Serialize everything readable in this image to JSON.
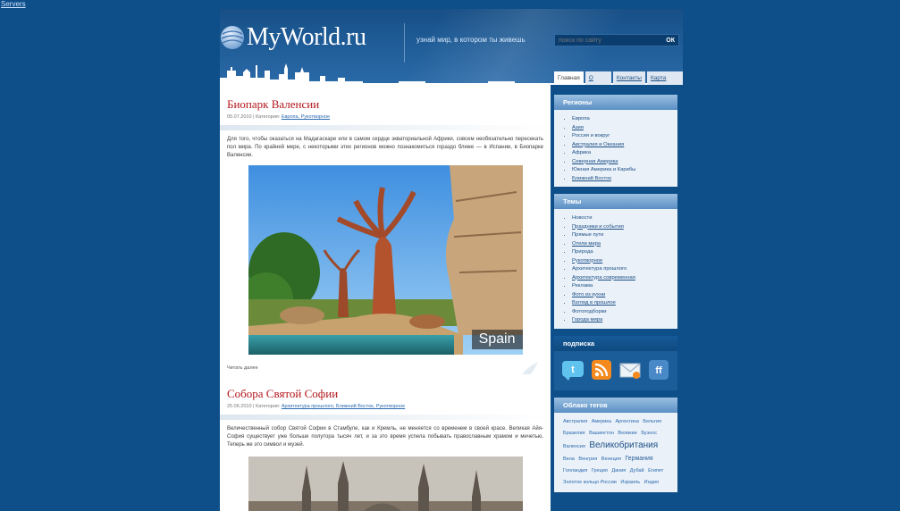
{
  "top_link": "Servers",
  "header": {
    "logo": "MyWorld.ru",
    "slogan": "узнай мир, в котором ты живешь",
    "search": {
      "placeholder": "поиск по сайту",
      "button": "ОК"
    },
    "nav": [
      {
        "label": "Главная",
        "active": true
      },
      {
        "label": "О сайте",
        "active": false
      },
      {
        "label": "Контакты",
        "active": false
      },
      {
        "label": "Карта сайта",
        "active": false
      }
    ]
  },
  "posts": [
    {
      "title": "Биопарк Валенсии",
      "date": "05.07.2010",
      "category_label": "Категория:",
      "categories": "Европа, Рукотворное",
      "excerpt": "Для того, чтобы оказаться на Мадагаскаре или в самом сердце экваториальной Африки, совсем необязательно пересекать пол мира. По крайней мере, с некоторыми этих регионов можно познакомиться гораздо ближе — в Испании, в Биопарке Валенсии.",
      "photo_label": "Spain",
      "author": "Читать далее"
    },
    {
      "title": "Собора Святой Софии",
      "date": "25.06.2010",
      "category_label": "Категория:",
      "categories": "Архитектура прошлого, Ближний Восток, Рукотворное",
      "excerpt": "Величественный собор Святой Софии в Стамбуле, как и Кремль, не меняется со временем в своей красе. Великая Айя-София существует уже больше полутора тысяч лет, и за это время успела побывать православным храмом и мечетью. Теперь же это символ и музей."
    }
  ],
  "sidebar": {
    "regions": {
      "title": "Регионы",
      "items": [
        "Европа",
        "Азия",
        "Россия и вокруг",
        "Австралия и Океания",
        "Африка",
        "Северная Америка",
        "Южная Америка и Карибы",
        "Ближний Восток"
      ]
    },
    "topics": {
      "title": "Темы",
      "items": [
        "Новости",
        "Праздники и события",
        "Прямые пути",
        "Отели мира",
        "Природа",
        "Рукотворное",
        "Архитектура прошлого",
        "Архитектура современная",
        "Реклама",
        "Фото из кухни",
        "Взгляд в прошлое",
        "Фотоподборки",
        "Города мира"
      ]
    },
    "subscribe": {
      "title": "подписка",
      "icons": [
        "twitter-icon",
        "rss-icon",
        "email-icon",
        "friendfeed-icon"
      ]
    },
    "tags": {
      "title": "Облако тегов",
      "items": [
        {
          "t": "Австралия",
          "s": "s"
        },
        {
          "t": "Америка",
          "s": "s"
        },
        {
          "t": "Аргентина",
          "s": "s"
        },
        {
          "t": "Бельгия",
          "s": "s"
        },
        {
          "t": "Бразилия",
          "s": "s"
        },
        {
          "t": "Вашингтон",
          "s": "s"
        },
        {
          "t": "Великие",
          "s": "s"
        },
        {
          "t": "Буэнос",
          "s": "s"
        },
        {
          "t": "Валенсия",
          "s": "s"
        },
        {
          "t": "Великобритания",
          "s": "big"
        },
        {
          "t": "Вена",
          "s": "s"
        },
        {
          "t": "Венгрия",
          "s": "s"
        },
        {
          "t": "Венеция",
          "s": "s"
        },
        {
          "t": "Германия",
          "s": "mid"
        },
        {
          "t": "Голландия",
          "s": "s"
        },
        {
          "t": "Греция",
          "s": "s"
        },
        {
          "t": "Дания",
          "s": "s"
        },
        {
          "t": "Дубай",
          "s": "s"
        },
        {
          "t": "Египет",
          "s": "s"
        },
        {
          "t": "Золотое кольцо России",
          "s": "s"
        },
        {
          "t": "Израиль",
          "s": "s"
        },
        {
          "t": "Индия",
          "s": "s"
        }
      ]
    }
  }
}
